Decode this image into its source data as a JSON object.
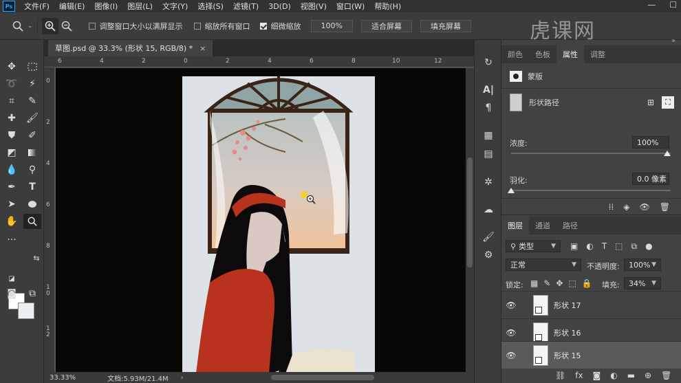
{
  "menubar": {
    "logo": "Ps",
    "items": [
      "文件(F)",
      "编辑(E)",
      "图像(I)",
      "图层(L)",
      "文字(Y)",
      "选择(S)",
      "滤镜(T)",
      "3D(D)",
      "视图(V)",
      "窗口(W)",
      "帮助(H)"
    ],
    "minimize": "—",
    "maximize": "☐"
  },
  "options": {
    "resize_windows": "调整窗口大小以满屏显示",
    "zoom_all_windows": "缩放所有窗口",
    "scrubby_zoom": "细微缩放",
    "zoom_value": "100%",
    "fit_screen": "适合屏幕",
    "fill_screen": "填充屏幕",
    "resize_checked": false,
    "zoom_all_checked": false,
    "scrubby_checked": true
  },
  "watermark": "虎课网",
  "document": {
    "tab_title": "草图.psd @ 33.3% (形状 15, RGB/8) *",
    "close": "×",
    "zoom_status": "33.33%",
    "doc_status": "文档:5.93M/21.4M",
    "arrow": "›"
  },
  "ruler": {
    "h_labels": [
      "6",
      "4",
      "2",
      "0",
      "2",
      "4",
      "6",
      "8",
      "10",
      "12"
    ],
    "v_labels": [
      "0",
      "2",
      "4",
      "6",
      "8",
      "1\n0",
      "1\n2"
    ]
  },
  "properties": {
    "tabs": [
      "颜色",
      "色板",
      "属性",
      "调整"
    ],
    "active_tab": "属性",
    "mask_label": "蒙版",
    "shape_path_label": "形状路径",
    "density_label": "浓度:",
    "density_value": "100%",
    "density": 1.0,
    "feather_label": "羽化:",
    "feather_value": "0.0 像素",
    "feather": 0.0
  },
  "layers": {
    "tabs": [
      "图层",
      "通道",
      "路径"
    ],
    "active_tab": "图层",
    "filter_kind": "类型",
    "blend_mode": "正常",
    "opacity_label": "不透明度:",
    "opacity_value": "100%",
    "lock_label": "锁定:",
    "fill_label": "填充:",
    "fill_value": "34%",
    "items": [
      {
        "name": "形状 17",
        "visible": true,
        "selected": false
      },
      {
        "name": "形状 16",
        "visible": true,
        "selected": false
      },
      {
        "name": "形状 15",
        "visible": true,
        "selected": true
      }
    ],
    "footer_fx": "fx"
  },
  "colors": {
    "canvas_bg": "#080807",
    "wall": "#dde2e6",
    "window_frame": "#3a2418",
    "dress": "#b8321e",
    "hair": "#0c0a0a",
    "sky_top": "#bcc4c4",
    "sky_bottom": "#f0c8a2"
  }
}
